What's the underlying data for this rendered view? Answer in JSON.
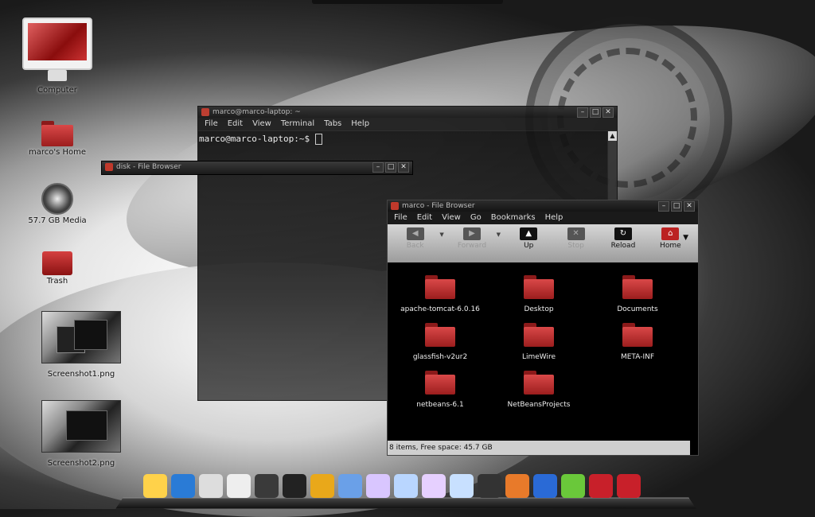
{
  "desktop": {
    "icons": [
      {
        "label": "Computer"
      },
      {
        "label": "marco's Home"
      },
      {
        "label": "57.7 GB Media"
      },
      {
        "label": "Trash"
      },
      {
        "label": "Screenshot1.png"
      },
      {
        "label": "Screenshot2.png"
      }
    ]
  },
  "terminal": {
    "title": "marco@marco-laptop: ~",
    "menu": [
      "File",
      "Edit",
      "View",
      "Terminal",
      "Tabs",
      "Help"
    ],
    "prompt": "marco@marco-laptop:~$"
  },
  "disk_window": {
    "title": "disk - File Browser"
  },
  "file_browser": {
    "title": "marco - File Browser",
    "menu": [
      "File",
      "Edit",
      "View",
      "Go",
      "Bookmarks",
      "Help"
    ],
    "toolbar": {
      "back": "Back",
      "forward": "Forward",
      "up": "Up",
      "stop": "Stop",
      "reload": "Reload",
      "home": "Home"
    },
    "items": [
      "apache-tomcat-6.0.16",
      "Desktop",
      "Documents",
      "glassfish-v2ur2",
      "LimeWire",
      "META-INF",
      "netbeans-6.1",
      "NetBeansProjects"
    ],
    "status": "8 items, Free space: 45.7 GB"
  },
  "window_controls": {
    "minimize": "–",
    "maximize": "□",
    "close": "✕"
  },
  "dock": {
    "icons": [
      "penguin-icon",
      "download-icon",
      "tux-icon",
      "clock-icon",
      "ipod-icon",
      "terminal-icon",
      "box-icon",
      "image-icon",
      "document-icon",
      "spreadsheet-icon",
      "presentation-icon",
      "text-icon",
      "film-icon",
      "firefox-icon",
      "bluetooth-icon",
      "messenger-icon",
      "folder-icon",
      "folder-icon"
    ],
    "colors": [
      "#ffd24a",
      "#2a7bd6",
      "#dddddd",
      "#eeeeee",
      "#3a3a3a",
      "#222222",
      "#e9a81a",
      "#6aa0e8",
      "#d9c6ff",
      "#b9d6ff",
      "#e6d0ff",
      "#c8e0ff",
      "#333333",
      "#e87a2a",
      "#2a6ad6",
      "#6ac83a",
      "#c8202a",
      "#c8202a"
    ]
  }
}
